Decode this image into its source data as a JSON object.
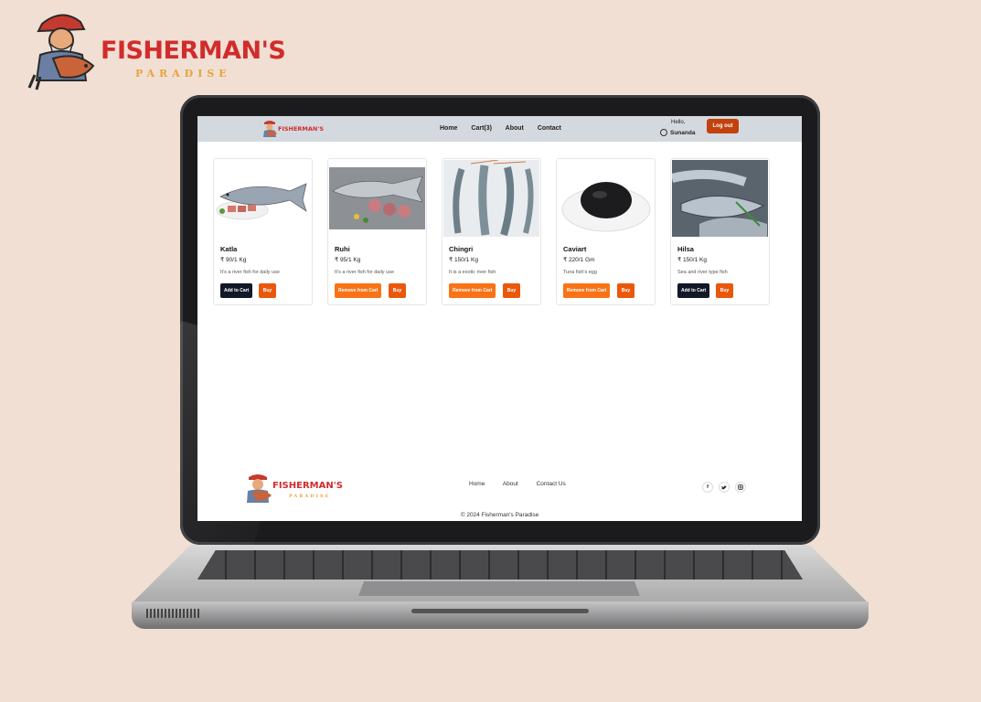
{
  "brand": {
    "name": "FISHERMAN'S",
    "sub": "PARADISE"
  },
  "nav": {
    "logo_text": "FISHERMAN'S",
    "links": [
      "Home",
      "Cart(3)",
      "About",
      "Contact"
    ],
    "hello": "Hello,",
    "user": "Sunanda",
    "logout": "Log out"
  },
  "products": [
    {
      "name": "Katla",
      "price": "₹ 90/1 Kg",
      "desc": "It's a river fish for daily use",
      "btn1": "Add to Cart",
      "btn1_style": "dark",
      "btn2": "Buy"
    },
    {
      "name": "Ruhi",
      "price": "₹ 95/1 Kg",
      "desc": "It's a river fish for daily use",
      "btn1": "Remove from Cart",
      "btn1_style": "orange",
      "btn2": "Buy"
    },
    {
      "name": "Chingri",
      "price": "₹ 150/1 Kg",
      "desc": "It is a exotic river fish",
      "btn1": "Remove from Cart",
      "btn1_style": "orange",
      "btn2": "Buy"
    },
    {
      "name": "Caviart",
      "price": "₹ 220/1 Gm",
      "desc": "Tuna fish's egg",
      "btn1": "Remove from Cart",
      "btn1_style": "orange",
      "btn2": "Buy"
    },
    {
      "name": "Hilsa",
      "price": "₹ 150/1 Kg",
      "desc": "Sea and river type fish",
      "btn1": "Add to Cart",
      "btn1_style": "dark",
      "btn2": "Buy"
    }
  ],
  "footer": {
    "logo_text": "FISHERMAN'S",
    "logo_sub": "PARADISE",
    "links": [
      "Home",
      "About",
      "Contact Us"
    ],
    "social_icons": [
      "facebook-icon",
      "twitter-icon",
      "instagram-icon"
    ],
    "copyright": "© 2024 Fisherman's Paradise"
  },
  "colors": {
    "accent": "#c2410c",
    "orange": "#f97316",
    "dark": "#111827",
    "page_bg": "#f1dfd3",
    "logo_red": "#d12c2c",
    "logo_gold": "#e7a43c"
  }
}
